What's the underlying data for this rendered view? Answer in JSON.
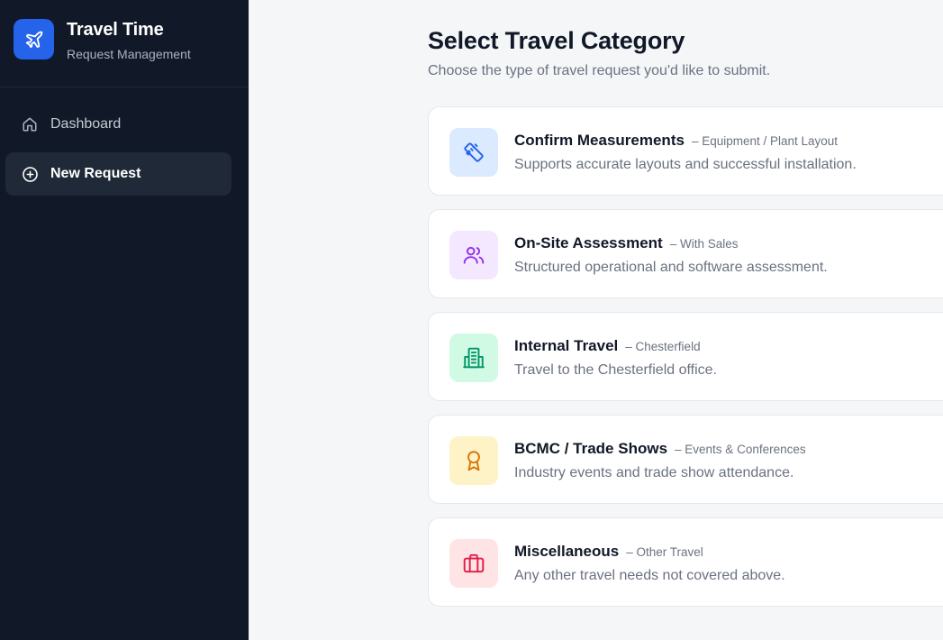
{
  "sidebar": {
    "brand": {
      "title": "Travel Time",
      "subtitle": "Request Management",
      "logo_icon": "airplane-icon",
      "logo_color": "#2563eb"
    },
    "nav": [
      {
        "label": "Dashboard",
        "icon": "home-icon",
        "active": false
      },
      {
        "label": "New Request",
        "icon": "plus-circle-icon",
        "active": true
      }
    ]
  },
  "main": {
    "title": "Select Travel Category",
    "subtitle": "Choose the type of travel request you'd like to submit.",
    "categories": [
      {
        "title": "Confirm Measurements",
        "tag": "– Equipment / Plant Layout",
        "description": "Supports accurate layouts and successful installation.",
        "icon": "ruler-icon",
        "icon_color": "#2563eb",
        "icon_bg": "#dbeafe"
      },
      {
        "title": "On-Site Assessment",
        "tag": "– With Sales",
        "description": "Structured operational and software assessment.",
        "icon": "users-icon",
        "icon_color": "#9333ea",
        "icon_bg": "#f3e8ff"
      },
      {
        "title": "Internal Travel",
        "tag": "– Chesterfield",
        "description": "Travel to the Chesterfield office.",
        "icon": "building-icon",
        "icon_color": "#059669",
        "icon_bg": "#d1fae5"
      },
      {
        "title": "BCMC / Trade Shows",
        "tag": "– Events & Conferences",
        "description": "Industry events and trade show attendance.",
        "icon": "award-icon",
        "icon_color": "#d97706",
        "icon_bg": "#fef3c7"
      },
      {
        "title": "Miscellaneous",
        "tag": "– Other Travel",
        "description": "Any other travel needs not covered above.",
        "icon": "briefcase-icon",
        "icon_color": "#e11d48",
        "icon_bg": "#ffe4e6"
      }
    ]
  }
}
